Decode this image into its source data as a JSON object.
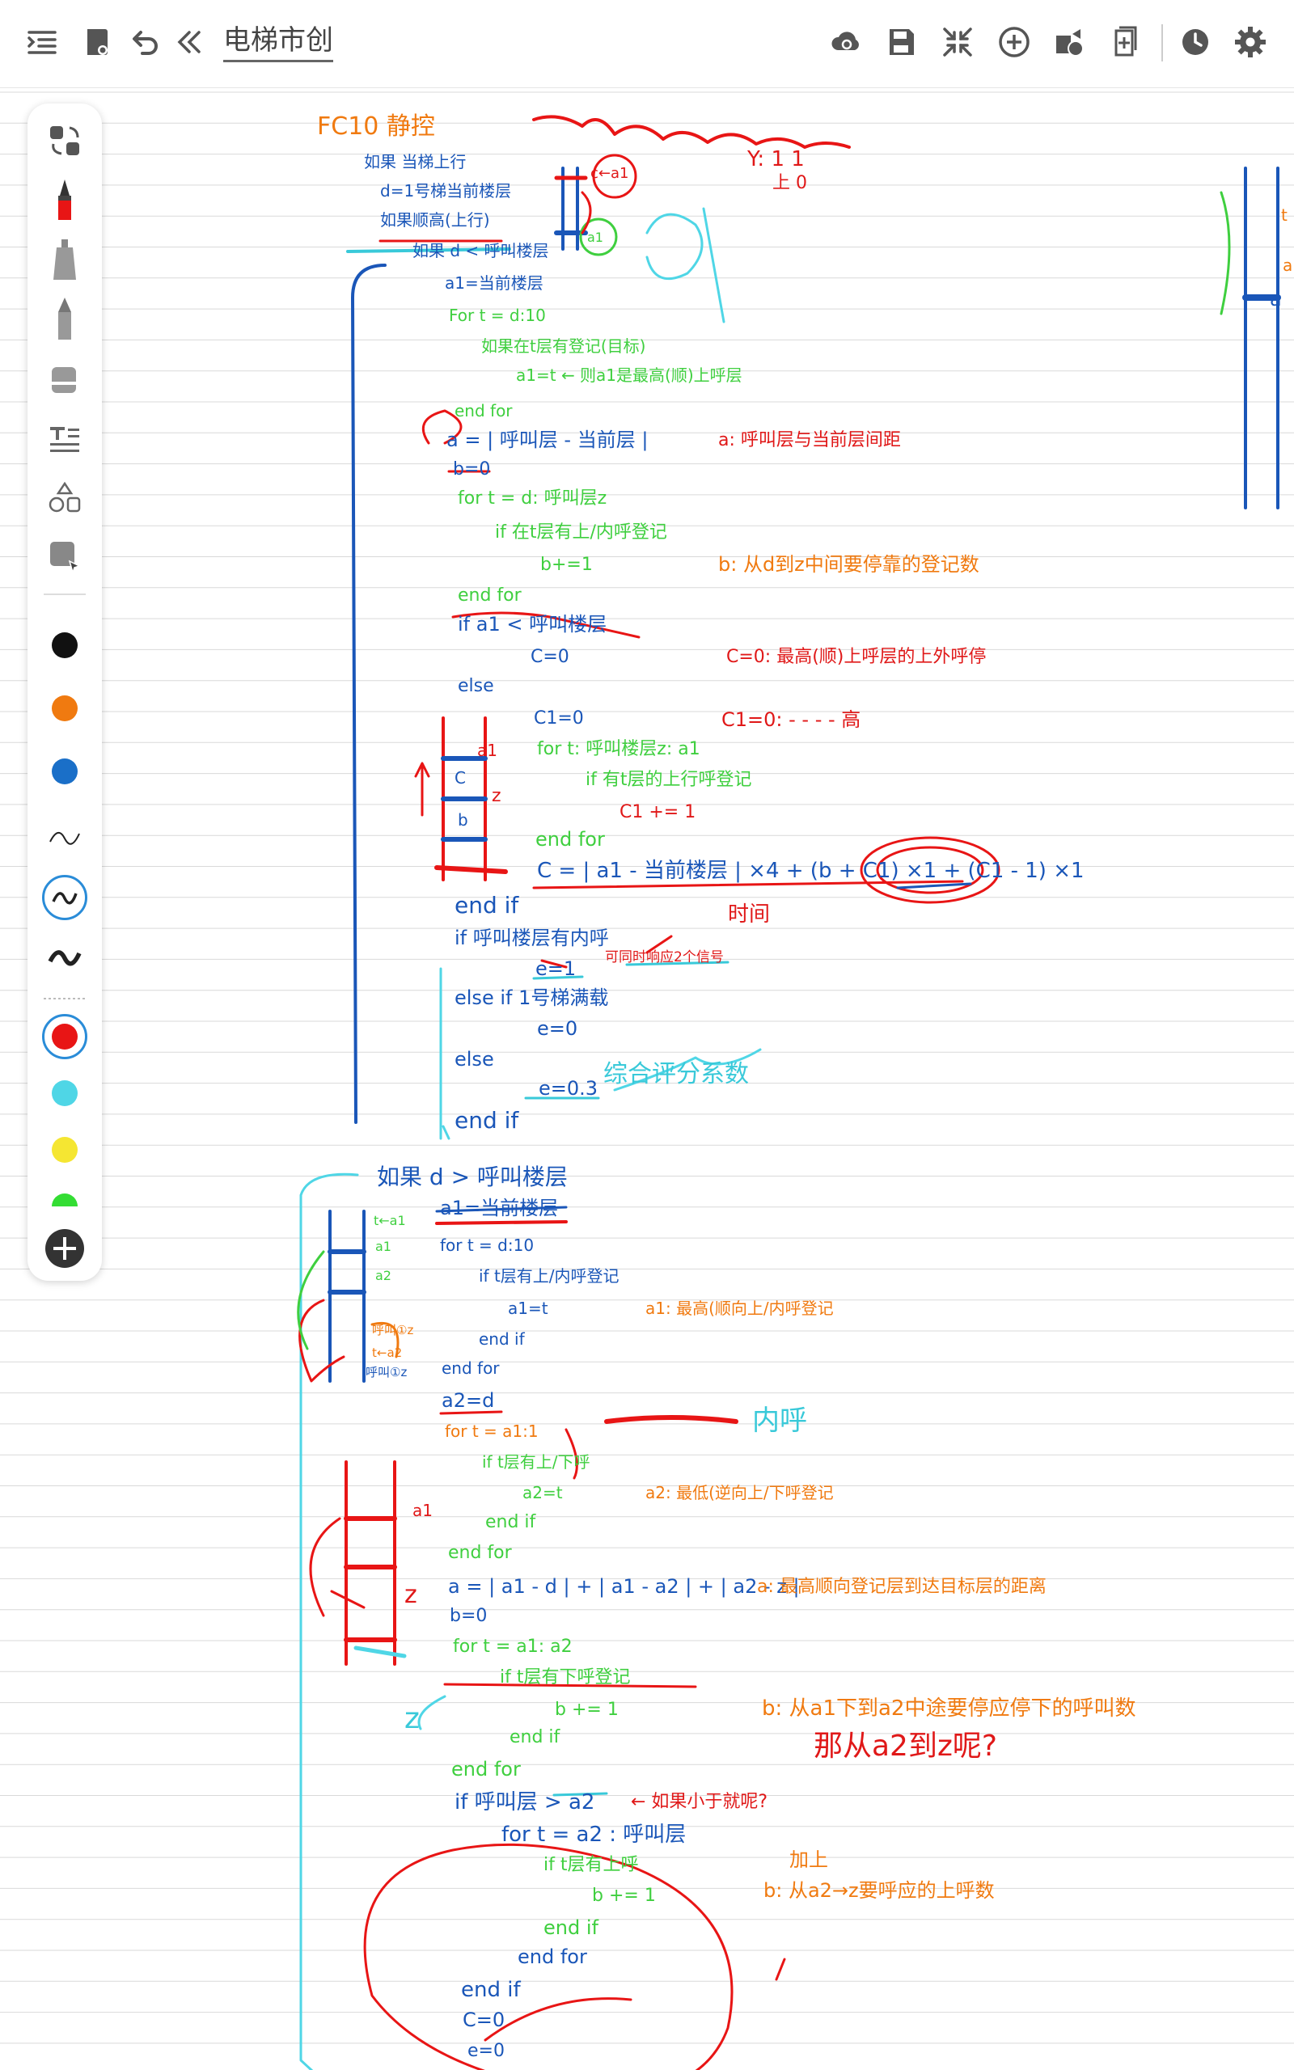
{
  "toolbar": {
    "title": "电梯市创",
    "colors": {
      "icon": "#555555"
    },
    "left_icons": [
      "sidebar-toggle-icon",
      "notebook-icon",
      "undo-icon",
      "collapse-icon"
    ],
    "right_icons": [
      "cloud-sync-icon",
      "save-icon",
      "shrink-icon",
      "add-page-icon",
      "share-icon",
      "export-icon",
      "history-icon",
      "settings-icon"
    ]
  },
  "palette": {
    "tools": [
      "lasso-icon",
      "fountain-pen-icon",
      "highlighter-icon",
      "pencil-icon",
      "eraser-icon",
      "text-icon",
      "shapes-icon",
      "select-icon"
    ],
    "colors": [
      "#111111",
      "#f07a10",
      "#1a6fc8"
    ],
    "pen_sizes": [
      "thin",
      "medium",
      "thick"
    ],
    "selected_color": "#e81515",
    "colors2": [
      "#e81515",
      "#4fd6e6",
      "#f5e632",
      "#33dd33"
    ]
  },
  "notes": {
    "l01": "FC10 静控",
    "l02": "如果 当梯上行",
    "l03": "d=1号梯当前楼层",
    "l04": "如果顺高(上行)",
    "l05": "如果 d < 呼叫楼层",
    "l06": "Y: 1 1",
    "l07": "上 0",
    "l08": "a1=当前楼层",
    "l09": "For t = d:10",
    "l10": "如果在t层有登记(目标)",
    "l11": "a1=t ← 则a1是最高(顺)上呼层",
    "l12": "end for",
    "l13": "a = | 呼叫层 - 当前层 |",
    "l14": "a: 呼叫层与当前层间距",
    "l15": "b=0",
    "l16": "for t = d: 呼叫层z",
    "l17": "if 在t层有上/内呼登记",
    "l18": "b+=1",
    "l19": "b: 从d到z中间要停靠的登记数",
    "l20": "end for",
    "l21": "if a1 < 呼叫楼层",
    "l22": "C=0",
    "l23": "C=0: 最高(顺)上呼层的上外呼停",
    "l24": "else",
    "l25": "C1=0",
    "l26": "C1=0: - - - - 高",
    "l27": "for t: 呼叫楼层z: a1",
    "l28": "if 有t层的上行呼登记",
    "l29": "C1 += 1",
    "l30": "end for",
    "l31": "C = | a1 - 当前楼层 | ×4 + (b + C1) ×1 + (C1 - 1) ×1",
    "l32": "end if",
    "l33": "时间",
    "l34": "if 呼叫楼层有内呼",
    "l35": "可同时响应2个信号",
    "l36": "e=1",
    "l37": "else if 1号梯满载",
    "l38": "e=0",
    "l39": "else",
    "l40": "e=0.3",
    "l41": "综合评分系数",
    "l42": "end if",
    "l43": "如果 d > 呼叫楼层",
    "l44": "a1=当前楼层",
    "l45": "for t = d:10",
    "l46": "if t层有上/内呼登记",
    "l47": "a1=t",
    "l48": "a1: 最高(顺向上/内呼登记",
    "l49": "end if",
    "l50": "end for",
    "l51": "a2=d",
    "l52": "for t = a1:1",
    "l53": "if t层有上/下呼",
    "l54": "a2=t",
    "l55": "a2: 最低(逆向上/下呼登记",
    "l56": "内呼",
    "l57": "end if",
    "l58": "end for",
    "l59": "a = | a1 - d | + | a1 - a2 | + | a2 - z |",
    "l60": "a: 最高顺向登记层到达目标层的距离",
    "l61": "b=0",
    "l62": "for t = a1: a2",
    "l63": "if t层有下呼登记",
    "l64": "b += 1",
    "l65": "b: 从a1下到a2中途要停应停下的呼叫数",
    "l66": "那从a2到z呢?",
    "l67": "end if",
    "l68": "end for",
    "l69": "if 呼叫层 > a2",
    "l70": "← 如果小于就呢?",
    "l71": "for t = a2 : 呼叫层",
    "l72": "if t层有上呼",
    "l73": "b += 1",
    "l74": "加上",
    "l75": "b: 从a2→z要呼应的上呼数",
    "l76": "end if",
    "l77": "end for",
    "l78": "end if",
    "l79": "C=0",
    "l80": "e=0",
    "s01": "c←a1",
    "s02": "a1",
    "s03": "a1",
    "s04": "C",
    "s05": "b",
    "s06": "z",
    "s07": "t←a1",
    "s08": "a1",
    "s09": "a2",
    "s10": "呼叫①z",
    "s11": "t←a2",
    "s12": "呼叫①z",
    "s13": "a1",
    "s14": "z",
    "s15": "z",
    "s16": "a",
    "s17": "t",
    "s18": "a"
  }
}
